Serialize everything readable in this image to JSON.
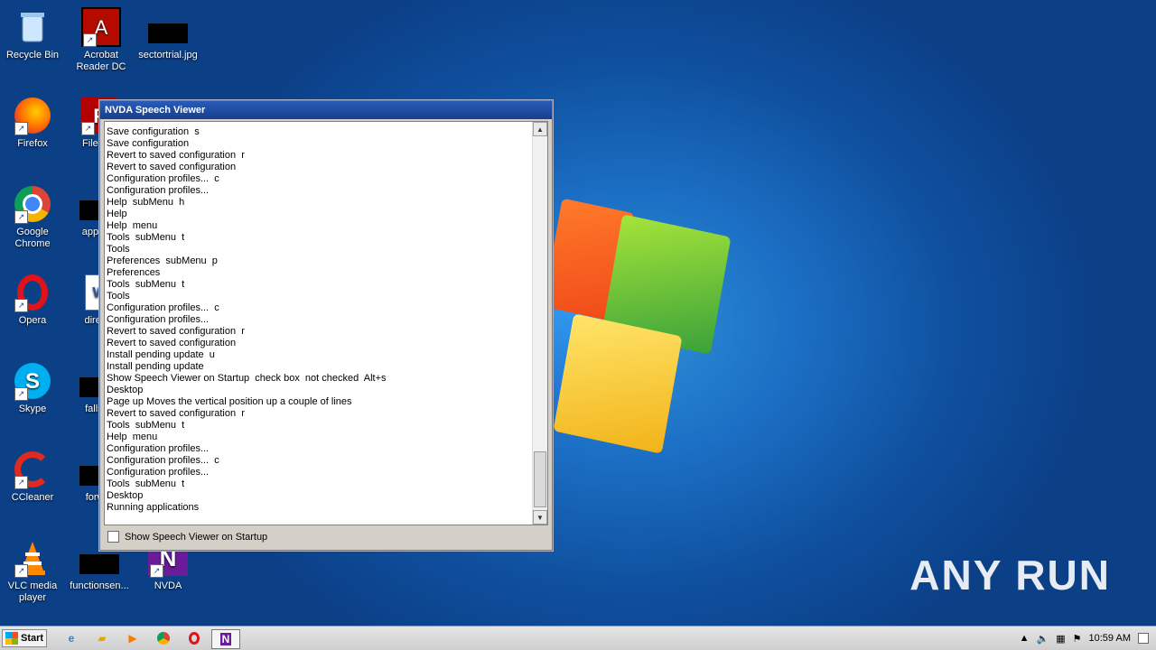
{
  "desktop": {
    "icons": [
      {
        "label": "Recycle Bin"
      },
      {
        "label": "Acrobat Reader DC"
      },
      {
        "label": "sectortrial.jpg"
      },
      {
        "label": "Firefox"
      },
      {
        "label": "FileZilla"
      },
      {
        "label": "Google Chrome"
      },
      {
        "label": "appliedt"
      },
      {
        "label": "Opera"
      },
      {
        "label": "directa"
      },
      {
        "label": "Skype"
      },
      {
        "label": "fallstat"
      },
      {
        "label": "CCleaner"
      },
      {
        "label": "forwar"
      },
      {
        "label": "VLC media player"
      },
      {
        "label": "functionsen..."
      },
      {
        "label": "NVDA"
      }
    ]
  },
  "window": {
    "title": "NVDA Speech Viewer",
    "lines": [
      "Save configuration  s",
      "Save configuration",
      "Revert to saved configuration  r",
      "Revert to saved configuration",
      "Configuration profiles...  c",
      "Configuration profiles...",
      "Help  subMenu  h",
      "Help",
      "Help  menu",
      "Tools  subMenu  t",
      "Tools",
      "Preferences  subMenu  p",
      "Preferences",
      "Tools  subMenu  t",
      "Tools",
      "Configuration profiles...  c",
      "Configuration profiles...",
      "Revert to saved configuration  r",
      "Revert to saved configuration",
      "Install pending update  u",
      "Install pending update",
      "Show Speech Viewer on Startup  check box  not checked  Alt+s",
      "Desktop",
      "Page up Moves the vertical position up a couple of lines",
      "Revert to saved configuration  r",
      "Tools  subMenu  t",
      "Help  menu",
      "Configuration profiles...",
      "Configuration profiles...  c",
      "Configuration profiles...",
      "Tools  subMenu  t",
      "Desktop",
      "Running applications"
    ],
    "checkbox_label": "Show Speech Viewer on Startup",
    "checkbox_checked": false
  },
  "taskbar": {
    "start_label": "Start",
    "clock": "10:59 AM"
  },
  "watermark": "ANY RUN"
}
